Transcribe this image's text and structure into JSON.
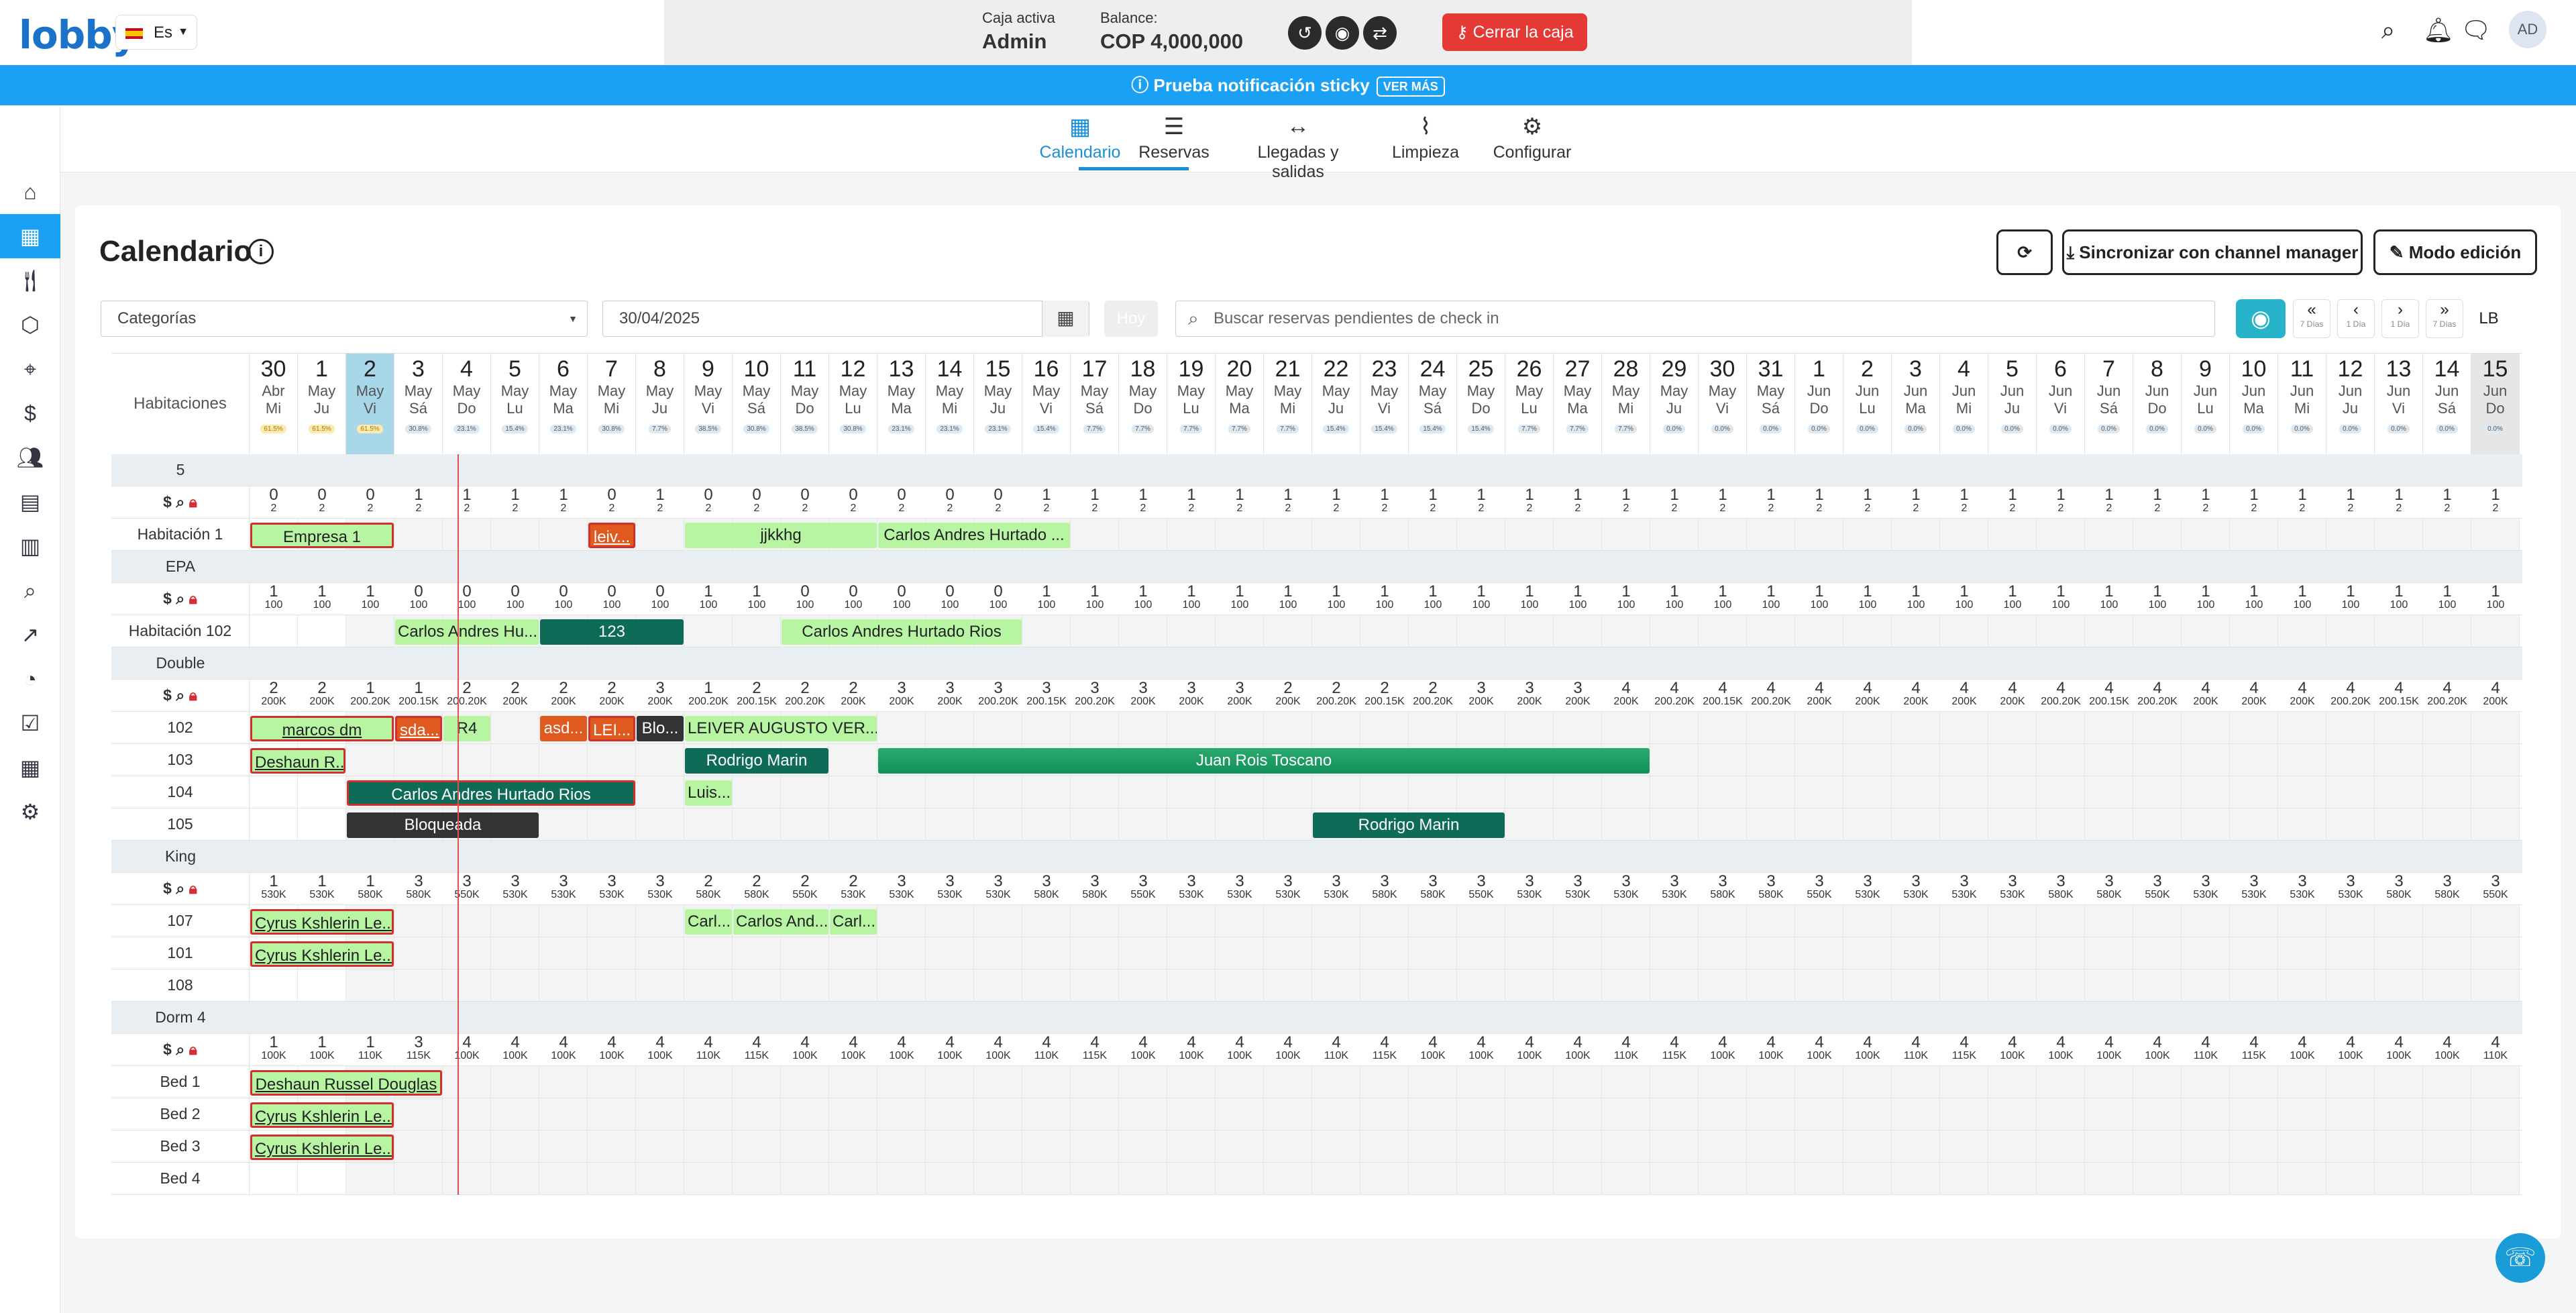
{
  "topbar": {
    "logo": "lobby",
    "language": "Es",
    "cash": {
      "active_label": "Caja activa",
      "active_value": "Admin",
      "balance_label": "Balance:",
      "balance_value": "COP 4,000,000",
      "close_label": "Cerrar la caja"
    },
    "avatar": "AD"
  },
  "notice": {
    "text": "Prueba notificación sticky",
    "more": "VER MÁS"
  },
  "nav": [
    {
      "label": "Calendario",
      "icon": "calendar-icon"
    },
    {
      "label": "Reservas",
      "icon": "list-icon"
    },
    {
      "label": "Llegadas y salidas",
      "icon": "arrows-icon"
    },
    {
      "label": "Limpieza",
      "icon": "broom-icon"
    },
    {
      "label": "Configurar",
      "icon": "gear-icon"
    }
  ],
  "page": {
    "title": "Calendario",
    "refresh": "⟳",
    "sync": "Sincronizar con channel manager",
    "edit": "Modo edición"
  },
  "filters": {
    "category": "Categorías",
    "date": "30/04/2025",
    "today": "Hoy",
    "search_placeholder": "Buscar reservas pendientes de check in",
    "lb": "LB"
  },
  "navbtns": [
    {
      "symbol": "«",
      "label": "7 Días"
    },
    {
      "symbol": "‹",
      "label": "1 Día"
    },
    {
      "symbol": "›",
      "label": "1 Día"
    },
    {
      "symbol": "»",
      "label": "7 Días"
    }
  ],
  "grid": {
    "rooms_header": "Habitaciones",
    "days": [
      {
        "d": "30",
        "m": "Abr",
        "w": "Mi",
        "p": "61.5%"
      },
      {
        "d": "1",
        "m": "May",
        "w": "Ju",
        "p": "61.5%"
      },
      {
        "d": "2",
        "m": "May",
        "w": "Vi",
        "p": "61.5%"
      },
      {
        "d": "3",
        "m": "May",
        "w": "Sá",
        "p": "30.8%"
      },
      {
        "d": "4",
        "m": "May",
        "w": "Do",
        "p": "23.1%"
      },
      {
        "d": "5",
        "m": "May",
        "w": "Lu",
        "p": "15.4%"
      },
      {
        "d": "6",
        "m": "May",
        "w": "Ma",
        "p": "23.1%"
      },
      {
        "d": "7",
        "m": "May",
        "w": "Mi",
        "p": "30.8%"
      },
      {
        "d": "8",
        "m": "May",
        "w": "Ju",
        "p": "7.7%"
      },
      {
        "d": "9",
        "m": "May",
        "w": "Vi",
        "p": "38.5%"
      },
      {
        "d": "10",
        "m": "May",
        "w": "Sá",
        "p": "30.8%"
      },
      {
        "d": "11",
        "m": "May",
        "w": "Do",
        "p": "38.5%"
      },
      {
        "d": "12",
        "m": "May",
        "w": "Lu",
        "p": "30.8%"
      },
      {
        "d": "13",
        "m": "May",
        "w": "Ma",
        "p": "23.1%"
      },
      {
        "d": "14",
        "m": "May",
        "w": "Mi",
        "p": "23.1%"
      },
      {
        "d": "15",
        "m": "May",
        "w": "Ju",
        "p": "23.1%"
      },
      {
        "d": "16",
        "m": "May",
        "w": "Vi",
        "p": "15.4%"
      },
      {
        "d": "17",
        "m": "May",
        "w": "Sá",
        "p": "7.7%"
      },
      {
        "d": "18",
        "m": "May",
        "w": "Do",
        "p": "7.7%"
      },
      {
        "d": "19",
        "m": "May",
        "w": "Lu",
        "p": "7.7%"
      },
      {
        "d": "20",
        "m": "May",
        "w": "Ma",
        "p": "7.7%"
      },
      {
        "d": "21",
        "m": "May",
        "w": "Mi",
        "p": "7.7%"
      },
      {
        "d": "22",
        "m": "May",
        "w": "Ju",
        "p": "15.4%"
      },
      {
        "d": "23",
        "m": "May",
        "w": "Vi",
        "p": "15.4%"
      },
      {
        "d": "24",
        "m": "May",
        "w": "Sá",
        "p": "15.4%"
      },
      {
        "d": "25",
        "m": "May",
        "w": "Do",
        "p": "15.4%"
      },
      {
        "d": "26",
        "m": "May",
        "w": "Lu",
        "p": "7.7%"
      },
      {
        "d": "27",
        "m": "May",
        "w": "Ma",
        "p": "7.7%"
      },
      {
        "d": "28",
        "m": "May",
        "w": "Mi",
        "p": "7.7%"
      },
      {
        "d": "29",
        "m": "May",
        "w": "Ju",
        "p": "0.0%"
      },
      {
        "d": "30",
        "m": "May",
        "w": "Vi",
        "p": "0.0%"
      },
      {
        "d": "31",
        "m": "May",
        "w": "Sá",
        "p": "0.0%"
      },
      {
        "d": "1",
        "m": "Jun",
        "w": "Do",
        "p": "0.0%"
      },
      {
        "d": "2",
        "m": "Jun",
        "w": "Lu",
        "p": "0.0%"
      },
      {
        "d": "3",
        "m": "Jun",
        "w": "Ma",
        "p": "0.0%"
      },
      {
        "d": "4",
        "m": "Jun",
        "w": "Mi",
        "p": "0.0%"
      },
      {
        "d": "5",
        "m": "Jun",
        "w": "Ju",
        "p": "0.0%"
      },
      {
        "d": "6",
        "m": "Jun",
        "w": "Vi",
        "p": "0.0%"
      },
      {
        "d": "7",
        "m": "Jun",
        "w": "Sá",
        "p": "0.0%"
      },
      {
        "d": "8",
        "m": "Jun",
        "w": "Do",
        "p": "0.0%"
      },
      {
        "d": "9",
        "m": "Jun",
        "w": "Lu",
        "p": "0.0%"
      },
      {
        "d": "10",
        "m": "Jun",
        "w": "Ma",
        "p": "0.0%"
      },
      {
        "d": "11",
        "m": "Jun",
        "w": "Mi",
        "p": "0.0%"
      },
      {
        "d": "12",
        "m": "Jun",
        "w": "Ju",
        "p": "0.0%"
      },
      {
        "d": "13",
        "m": "Jun",
        "w": "Vi",
        "p": "0.0%"
      },
      {
        "d": "14",
        "m": "Jun",
        "w": "Sá",
        "p": "0.0%"
      },
      {
        "d": "15",
        "m": "Jun",
        "w": "Do",
        "p": "0.0%"
      }
    ],
    "sections": [
      {
        "category": "5",
        "avail": [
          "0",
          "0",
          "0",
          "1",
          "1",
          "1",
          "1",
          "0",
          "1",
          "0",
          "0",
          "0",
          "0",
          "0",
          "0",
          "0",
          "1",
          "1",
          "1",
          "1",
          "1",
          "1",
          "1",
          "1",
          "1",
          "1",
          "1",
          "1",
          "1",
          "1",
          "1",
          "1",
          "1",
          "1",
          "1",
          "1",
          "1",
          "1",
          "1",
          "1",
          "1",
          "1",
          "1",
          "1",
          "1",
          "1",
          "1"
        ],
        "sub": [
          "2"
        ],
        "rooms": [
          {
            "name": "Habitación 1",
            "res": [
              {
                "s": 0,
                "n": 3,
                "t": "Empresa 1",
                "c": "lg redb"
              },
              {
                "s": 7,
                "n": 1,
                "t": "leiv...",
                "c": "or redb u"
              },
              {
                "s": 9,
                "n": 4,
                "t": "jjkkhg",
                "c": "lg"
              },
              {
                "s": 13,
                "n": 4,
                "t": "Carlos Andres Hurtado ...",
                "c": "lg"
              }
            ]
          }
        ]
      },
      {
        "category": "EPA",
        "avail": [
          "1",
          "1",
          "1",
          "0",
          "0",
          "0",
          "0",
          "0",
          "0",
          "1",
          "1",
          "0",
          "0",
          "0",
          "0",
          "0",
          "1",
          "1",
          "1",
          "1",
          "1",
          "1",
          "1",
          "1",
          "1",
          "1",
          "1",
          "1",
          "1",
          "1",
          "1",
          "1",
          "1",
          "1",
          "1",
          "1",
          "1",
          "1",
          "1",
          "1",
          "1",
          "1",
          "1",
          "1",
          "1",
          "1",
          "1"
        ],
        "sub": [
          "100"
        ],
        "rooms": [
          {
            "name": "Habitación 102",
            "res": [
              {
                "s": 3,
                "n": 3,
                "t": "Carlos Andres Hu...",
                "c": "lg"
              },
              {
                "s": 6,
                "n": 3,
                "t": "123",
                "c": "dg"
              },
              {
                "s": 11,
                "n": 5,
                "t": "Carlos Andres Hurtado Rios",
                "c": "lg"
              }
            ]
          }
        ]
      },
      {
        "category": "Double",
        "avail": [
          "2",
          "2",
          "1",
          "1",
          "2",
          "2",
          "2",
          "2",
          "3",
          "1",
          "2",
          "2",
          "2",
          "3",
          "3",
          "3",
          "3",
          "3",
          "3",
          "3",
          "3",
          "2",
          "2",
          "2",
          "2",
          "3",
          "3",
          "3",
          "4",
          "4",
          "4",
          "4",
          "4",
          "4",
          "4",
          "4",
          "4",
          "4",
          "4",
          "4",
          "4",
          "4",
          "4",
          "4",
          "4",
          "4",
          "4"
        ],
        "sub": [
          "200K",
          "200K",
          "200.20K",
          "200.15K",
          "200.20K",
          "200K",
          "200K",
          "200K",
          "200K",
          "200.20K",
          "200.15K",
          "200.20K",
          "200K",
          "200K",
          "200K",
          "200.20K",
          "200.15K",
          "200.20K",
          "200K",
          "200K",
          "200K",
          "200K",
          "200.20K",
          "200.15K",
          "200.20K",
          "200K",
          "200K",
          "200K",
          "200K",
          "200.20K",
          "200.15K",
          "200.20K",
          "200K",
          "200K",
          "200K",
          "200K",
          "200K",
          "200.20K",
          "200.15K",
          "200.20K",
          "200K",
          "200K",
          "200K",
          "200.20K",
          "200.15K",
          "200.20K",
          "200K"
        ],
        "rooms": [
          {
            "name": "102",
            "res": [
              {
                "s": 0,
                "n": 3,
                "t": "marcos dm",
                "c": "lg redb u"
              },
              {
                "s": 3,
                "n": 1,
                "t": "sda...",
                "c": "or redb u"
              },
              {
                "s": 4,
                "n": 1,
                "t": "R4",
                "c": "lg"
              },
              {
                "s": 6,
                "n": 1,
                "t": "asd...",
                "c": "or"
              },
              {
                "s": 7,
                "n": 1,
                "t": "LEI...",
                "c": "or redb"
              },
              {
                "s": 8,
                "n": 1,
                "t": "Blo...",
                "c": "bk"
              },
              {
                "s": 9,
                "n": 4,
                "t": "LEIVER AUGUSTO VER...",
                "c": "lg"
              }
            ]
          },
          {
            "name": "103",
            "res": [
              {
                "s": 0,
                "n": 2,
                "t": "Deshaun R...",
                "c": "lg redb u"
              },
              {
                "s": 9,
                "n": 3,
                "t": "Rodrigo Marin",
                "c": "dg"
              },
              {
                "s": 13,
                "n": 16,
                "t": "Juan Rois Toscano",
                "c": "gr"
              }
            ]
          },
          {
            "name": "104",
            "res": [
              {
                "s": 2,
                "n": 6,
                "t": "Carlos Andres Hurtado Rios",
                "c": "dg redb"
              },
              {
                "s": 9,
                "n": 1,
                "t": "Luis...",
                "c": "lg"
              }
            ]
          },
          {
            "name": "105",
            "res": [
              {
                "s": 2,
                "n": 4,
                "t": "Bloqueada",
                "c": "bk"
              },
              {
                "s": 22,
                "n": 4,
                "t": "Rodrigo Marin",
                "c": "dg"
              }
            ]
          }
        ]
      },
      {
        "category": "King",
        "avail": [
          "1",
          "1",
          "1",
          "3",
          "3",
          "3",
          "3",
          "3",
          "3",
          "2",
          "2",
          "2",
          "2",
          "3",
          "3",
          "3",
          "3",
          "3",
          "3",
          "3",
          "3",
          "3",
          "3",
          "3",
          "3",
          "3",
          "3",
          "3",
          "3",
          "3",
          "3",
          "3",
          "3",
          "3",
          "3",
          "3",
          "3",
          "3",
          "3",
          "3",
          "3",
          "3",
          "3",
          "3",
          "3",
          "3",
          "3"
        ],
        "sub": [
          "530K",
          "530K",
          "580K",
          "580K",
          "550K",
          "530K",
          "530K",
          "530K",
          "530K",
          "580K",
          "580K",
          "550K",
          "530K",
          "530K",
          "530K",
          "530K",
          "580K",
          "580K",
          "550K",
          "530K",
          "530K",
          "530K",
          "530K",
          "580K",
          "580K",
          "550K",
          "530K",
          "530K",
          "530K",
          "530K",
          "580K",
          "580K",
          "550K",
          "530K",
          "530K",
          "530K",
          "530K",
          "580K",
          "580K",
          "550K",
          "530K",
          "530K",
          "530K",
          "530K",
          "580K",
          "580K",
          "550K"
        ],
        "rooms": [
          {
            "name": "107",
            "res": [
              {
                "s": 0,
                "n": 3,
                "t": "Cyrus Kshlerin Le...",
                "c": "lg redb u"
              },
              {
                "s": 9,
                "n": 1,
                "t": "Carl...",
                "c": "lg"
              },
              {
                "s": 10,
                "n": 2,
                "t": "Carlos And...",
                "c": "lg"
              },
              {
                "s": 12,
                "n": 1,
                "t": "Carl...",
                "c": "lg"
              }
            ]
          },
          {
            "name": "101",
            "res": [
              {
                "s": 0,
                "n": 3,
                "t": "Cyrus Kshlerin Le...",
                "c": "lg redb u"
              }
            ]
          },
          {
            "name": "108",
            "res": []
          }
        ]
      },
      {
        "category": "Dorm 4",
        "avail": [
          "1",
          "1",
          "1",
          "3",
          "4",
          "4",
          "4",
          "4",
          "4",
          "4",
          "4",
          "4",
          "4",
          "4",
          "4",
          "4",
          "4",
          "4",
          "4",
          "4",
          "4",
          "4",
          "4",
          "4",
          "4",
          "4",
          "4",
          "4",
          "4",
          "4",
          "4",
          "4",
          "4",
          "4",
          "4",
          "4",
          "4",
          "4",
          "4",
          "4",
          "4",
          "4",
          "4",
          "4",
          "4",
          "4",
          "4"
        ],
        "sub": [
          "100K",
          "100K",
          "110K",
          "115K",
          "100K",
          "100K",
          "100K",
          "100K",
          "100K",
          "110K",
          "115K",
          "100K",
          "100K",
          "100K",
          "100K",
          "100K",
          "110K",
          "115K",
          "100K",
          "100K",
          "100K",
          "100K",
          "110K",
          "115K",
          "100K",
          "100K",
          "100K",
          "100K",
          "110K",
          "115K",
          "100K",
          "100K",
          "100K",
          "100K",
          "110K",
          "115K",
          "100K",
          "100K",
          "100K",
          "100K",
          "110K",
          "115K",
          "100K",
          "100K",
          "100K",
          "100K",
          "110K"
        ],
        "rooms": [
          {
            "name": "Bed 1",
            "res": [
              {
                "s": 0,
                "n": 4,
                "t": "Deshaun Russel Douglas",
                "c": "lg redb u"
              }
            ]
          },
          {
            "name": "Bed 2",
            "res": [
              {
                "s": 0,
                "n": 3,
                "t": "Cyrus Kshlerin Le...",
                "c": "lg redb u"
              }
            ]
          },
          {
            "name": "Bed 3",
            "res": [
              {
                "s": 0,
                "n": 3,
                "t": "Cyrus Kshlerin Le...",
                "c": "lg redb u"
              }
            ]
          },
          {
            "name": "Bed 4",
            "res": []
          }
        ]
      }
    ]
  }
}
